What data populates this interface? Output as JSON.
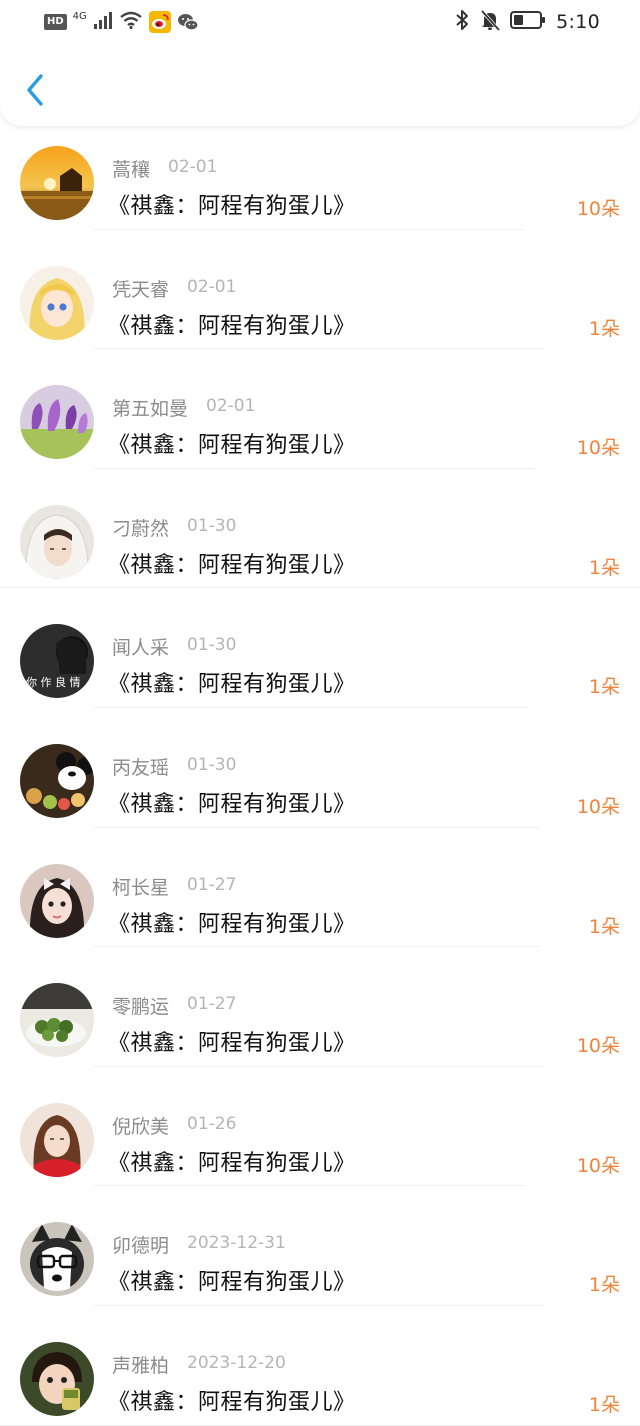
{
  "status_bar": {
    "hd": "HD",
    "network": "4G",
    "time": "5:10"
  },
  "header": {
    "back_icon": "chevron-left-icon",
    "accent_color": "#2a9be0"
  },
  "records": [
    {
      "name": "蒿穰",
      "date": "02-01",
      "title": "《祺鑫：阿程有狗蛋儿》",
      "count": "10朵",
      "avatar": "sunset-sea"
    },
    {
      "name": "凭天睿",
      "date": "02-01",
      "title": "《祺鑫：阿程有狗蛋儿》",
      "count": "1朵",
      "avatar": "anime-blonde-girl"
    },
    {
      "name": "第五如曼",
      "date": "02-01",
      "title": "《祺鑫：阿程有狗蛋儿》",
      "count": "10朵",
      "avatar": "purple-crocus-flowers"
    },
    {
      "name": "刁蔚然",
      "date": "01-30",
      "title": "《祺鑫：阿程有狗蛋儿》",
      "count": "1朵",
      "avatar": "girl-white-hood"
    },
    {
      "name": "闻人采",
      "date": "01-30",
      "title": "《祺鑫：阿程有狗蛋儿》",
      "count": "1朵",
      "avatar": "dark-text-photo"
    },
    {
      "name": "丙友瑶",
      "date": "01-30",
      "title": "《祺鑫：阿程有狗蛋儿》",
      "count": "10朵",
      "avatar": "cartoon-mouse-food"
    },
    {
      "name": "柯长星",
      "date": "01-27",
      "title": "《祺鑫：阿程有狗蛋儿》",
      "count": "1朵",
      "avatar": "girl-bow-portrait"
    },
    {
      "name": "零鹏运",
      "date": "01-27",
      "title": "《祺鑫：阿程有狗蛋儿》",
      "count": "10朵",
      "avatar": "green-fruit-bowl"
    },
    {
      "name": "倪欣美",
      "date": "01-26",
      "title": "《祺鑫：阿程有狗蛋儿》",
      "count": "10朵",
      "avatar": "girl-red-scarf"
    },
    {
      "name": "卯德明",
      "date": "2023-12-31",
      "title": "《祺鑫：阿程有狗蛋儿》",
      "count": "1朵",
      "avatar": "husky-with-glasses"
    },
    {
      "name": "声雅柏",
      "date": "2023-12-20",
      "title": "《祺鑫：阿程有狗蛋儿》",
      "count": "1朵",
      "avatar": "child-eating"
    }
  ]
}
